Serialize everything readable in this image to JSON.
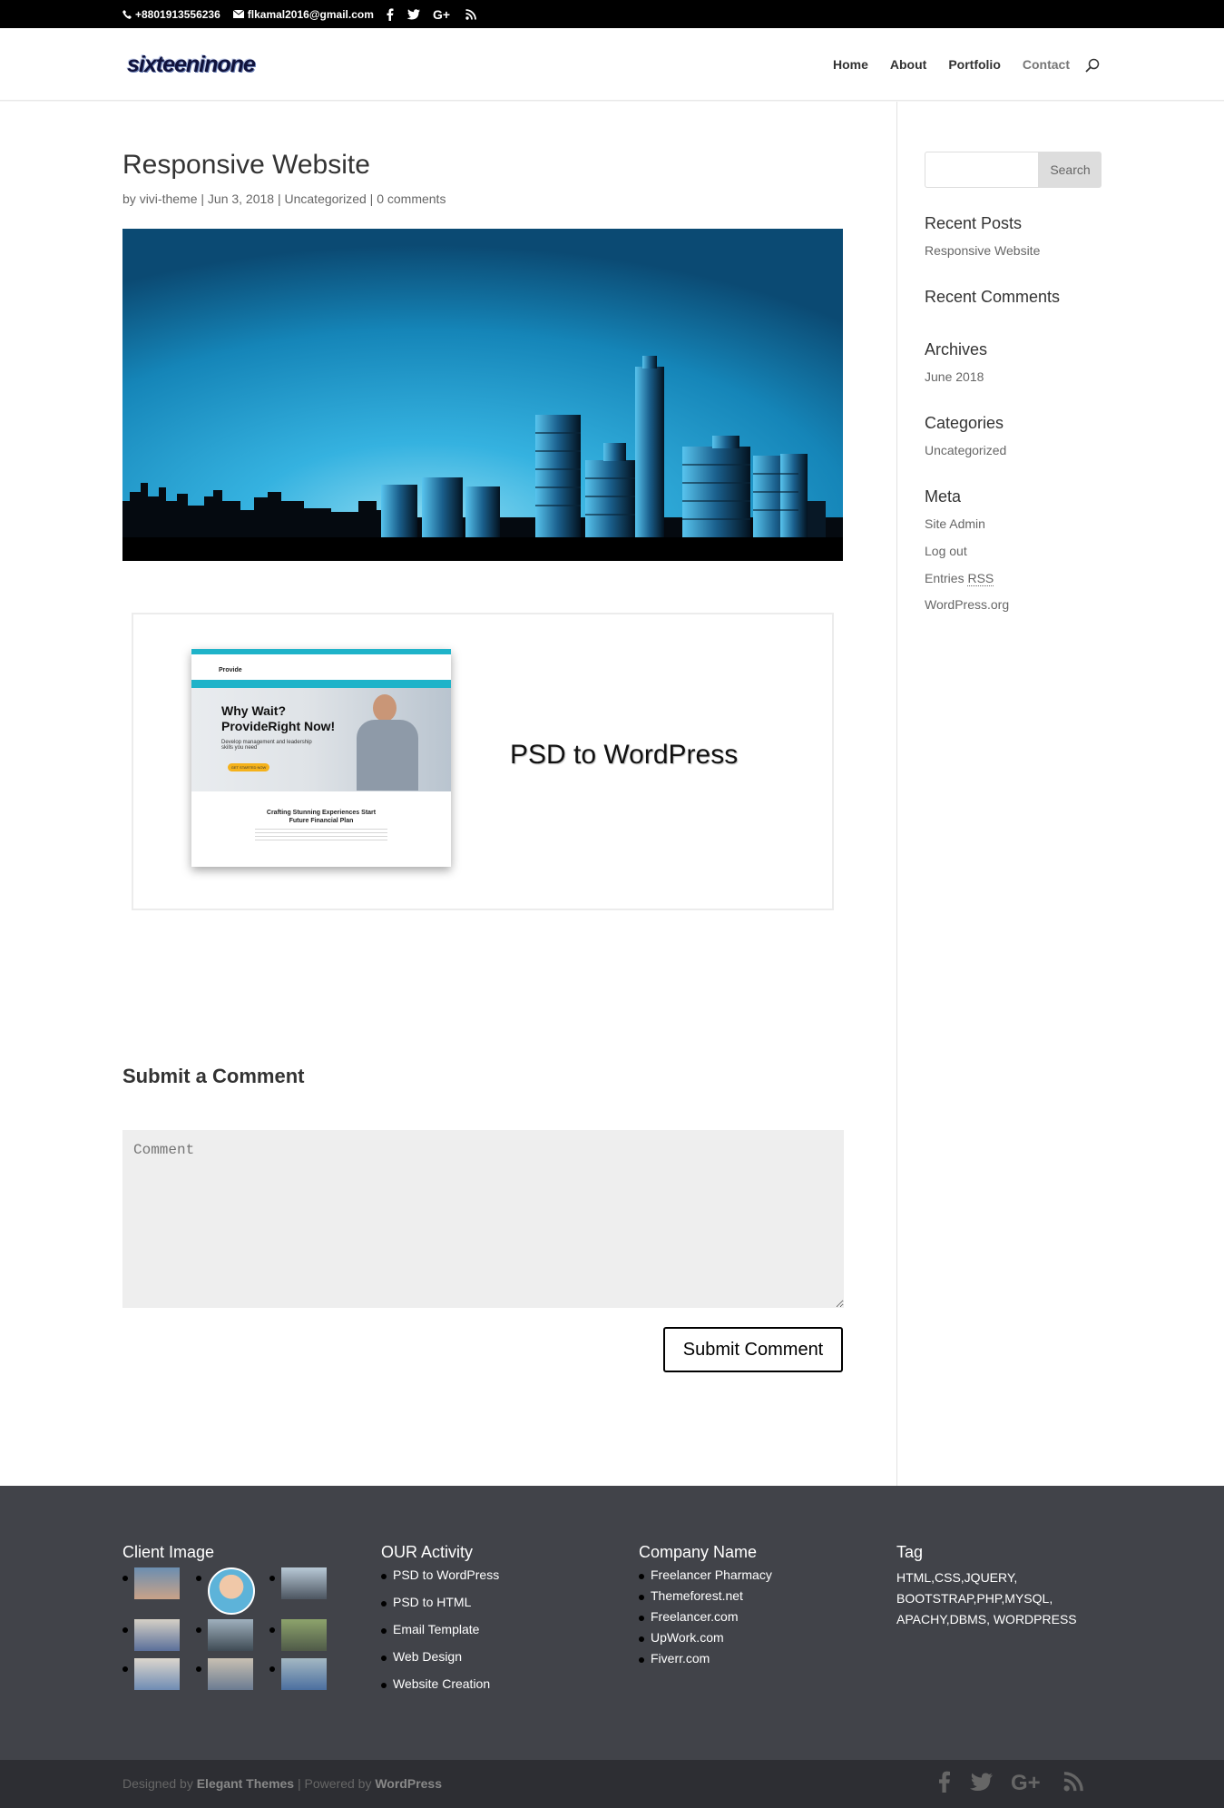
{
  "topbar": {
    "phone": "+8801913556236",
    "email": "flkamal2016@gmail.com"
  },
  "site": {
    "logo": "sixteeninone"
  },
  "nav": {
    "items": [
      {
        "label": "Home"
      },
      {
        "label": "About"
      },
      {
        "label": "Portfolio"
      },
      {
        "label": "Contact"
      }
    ]
  },
  "post": {
    "title": "Responsive Website",
    "meta": {
      "by": "by",
      "author": "vivi-theme",
      "date": "Jun 3, 2018",
      "category": "Uncategorized",
      "comments": "0 comments",
      "sep": "|"
    },
    "feature_text": "PSD to WordPress",
    "mock": {
      "brand": "Provide",
      "headline1": "Why Wait?",
      "headline2": "ProvideRight Now!",
      "sub": "Develop management and leadership skills you need",
      "cta": "GET STARTED NOW",
      "section1": "Crafting Stunning Experiences Start",
      "section2": "Future Financial Plan"
    }
  },
  "comment_form": {
    "title": "Submit a Comment",
    "placeholder": "Comment",
    "submit_label": "Submit Comment"
  },
  "sidebar": {
    "search_button": "Search",
    "recent_posts": {
      "title": "Recent Posts",
      "items": [
        "Responsive Website"
      ]
    },
    "recent_comments": {
      "title": "Recent Comments"
    },
    "archives": {
      "title": "Archives",
      "items": [
        "June 2018"
      ]
    },
    "categories": {
      "title": "Categories",
      "items": [
        "Uncategorized"
      ]
    },
    "meta": {
      "title": "Meta",
      "items": [
        "Site Admin",
        "Log out",
        "Entries",
        "WordPress.org"
      ],
      "rss": "RSS"
    }
  },
  "footer": {
    "client_image": {
      "title": "Client Image"
    },
    "activity": {
      "title": "OUR Activity",
      "items": [
        "PSD to WordPress",
        "PSD to HTML",
        "Email Template",
        "Web Design",
        "Website Creation"
      ]
    },
    "company": {
      "title": "Company Name",
      "items": [
        "Freelancer Pharmacy",
        "Themeforest.net",
        "Freelancer.com",
        "UpWork.com",
        "Fiverr.com"
      ]
    },
    "tag": {
      "title": "Tag",
      "text": "HTML,CSS,JQUERY, BOOTSTRAP,PHP,MYSQL, APACHY,DBMS, WORDPRESS"
    }
  },
  "bottom": {
    "designed_by": "Designed by",
    "elegant": "Elegant Themes",
    "powered_by": "| Powered by",
    "wordpress": "WordPress"
  },
  "icons": [
    "phone-icon",
    "email-icon",
    "facebook-icon",
    "twitter-icon",
    "google-plus-icon",
    "rss-icon",
    "search-icon"
  ],
  "colors": {
    "topbar": "#000000",
    "footer": "#414349",
    "bottom_bar": "#2d2e33",
    "hero_sky": "#1a9fd6"
  }
}
